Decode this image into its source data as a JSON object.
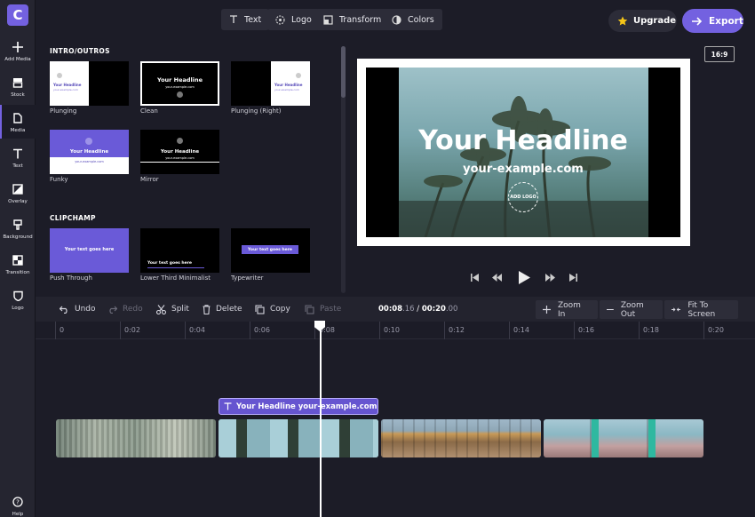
{
  "app": {
    "logo_letter": "C",
    "accent": "#7361e0"
  },
  "rail": [
    {
      "label": "Add Media",
      "icon": "plus-icon"
    },
    {
      "label": "Stock",
      "icon": "store-icon"
    },
    {
      "label": "Media",
      "icon": "file-icon",
      "active": true
    },
    {
      "label": "Text",
      "icon": "text-icon"
    },
    {
      "label": "Overlay",
      "icon": "overlay-icon"
    },
    {
      "label": "Background",
      "icon": "palette-icon"
    },
    {
      "label": "Transition",
      "icon": "transition-icon"
    },
    {
      "label": "Logo",
      "icon": "shield-icon"
    }
  ],
  "help_label": "Help",
  "toolbar": {
    "text": "Text",
    "logo": "Logo",
    "transform": "Transform",
    "colors": "Colors"
  },
  "upgrade_label": "Upgrade",
  "export_label": "Export",
  "library": {
    "intro_title": "INTRO/OUTROS",
    "clipchamp_title": "CLIPCHAMP",
    "templates": [
      {
        "label": "Plunging",
        "headline": "Your Headline",
        "sub": "your-example.com"
      },
      {
        "label": "Clean",
        "headline": "Your Headline",
        "sub": "your-example.com"
      },
      {
        "label": "Plunging (Right)",
        "headline": "Your Headline",
        "sub": "your-example.com"
      },
      {
        "label": "Funky",
        "headline": "Your Headline",
        "sub": "your-example.com"
      },
      {
        "label": "Mirror",
        "headline": "Your Headline",
        "sub": "your-example.com"
      },
      {
        "label": "Push Through",
        "headline": "Your text goes here"
      },
      {
        "label": "Lower Third Minimalist",
        "headline": "Your text goes here"
      },
      {
        "label": "Typewriter",
        "headline": "Your text goes here"
      }
    ]
  },
  "preview": {
    "aspect": "16:9",
    "headline": "Your Headline",
    "url": "your-example.com",
    "logo_placeholder": "ADD LOGO"
  },
  "edit": {
    "undo": "Undo",
    "redo": "Redo",
    "split": "Split",
    "delete": "Delete",
    "copy": "Copy",
    "paste": "Paste"
  },
  "time": {
    "current_main": "00:08",
    "current_frac": ".16",
    "sep": " / ",
    "total_main": "00:20",
    "total_frac": ".00"
  },
  "zoom": {
    "zoom_in": "Zoom In",
    "zoom_out": "Zoom Out",
    "fit": "Fit To Screen"
  },
  "ruler_ticks": [
    "0",
    "0:02",
    "0:04",
    "0:06",
    "0:08",
    "0:10",
    "0:12",
    "0:14",
    "0:16",
    "0:18",
    "0:20"
  ],
  "text_clip_label": "Your Headline your-example.com"
}
